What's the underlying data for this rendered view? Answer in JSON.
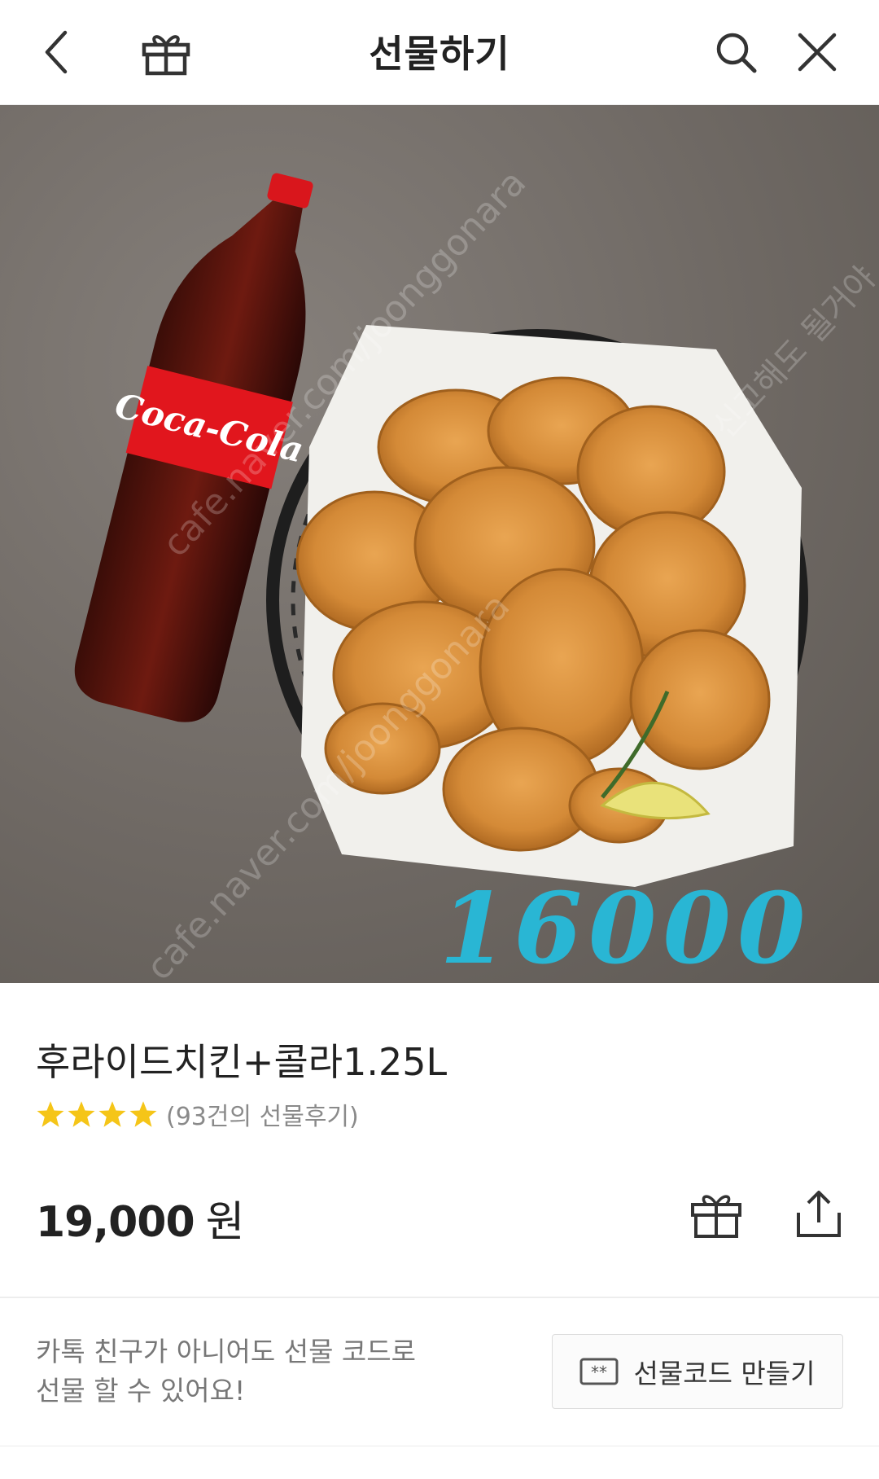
{
  "header": {
    "title": "선물하기",
    "back_icon": "chevron-left-icon",
    "gift_icon": "gift-icon",
    "search_icon": "search-icon",
    "close_icon": "close-icon"
  },
  "product": {
    "image_watermarks": [
      "cafe.naver.com/joonggonara",
      "신고해도 될거야",
      "cafe.naver.com/joonggonara"
    ],
    "image_price_text": "16000",
    "bottle_label": "Coca-Cola",
    "name": "후라이드치킨+콜라1.25L",
    "rating_stars": 4,
    "rating_star_color": "#f5c518",
    "review_text": "(93건의 선물후기)",
    "price": "19,000",
    "currency": "원"
  },
  "promo": {
    "line1": "카톡 친구가 아니어도 선물 코드로",
    "line2": "선물 할 수 있어요!",
    "button_label": "선물코드 만들기"
  },
  "colors": {
    "accent_price": "#29b6d4",
    "background": "#ffffff"
  }
}
